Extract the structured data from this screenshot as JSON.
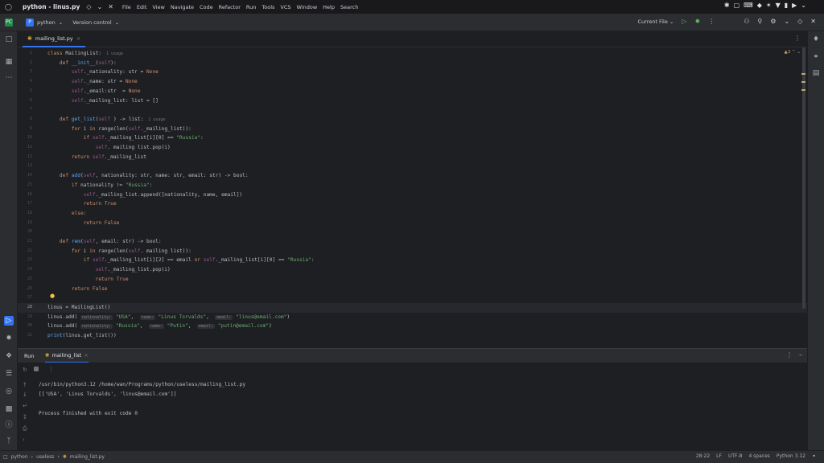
{
  "window": {
    "title": "python - linus.py",
    "menu": [
      "File",
      "Edit",
      "View",
      "Navigate",
      "Code",
      "Refactor",
      "Run",
      "Tools",
      "VCS",
      "Window",
      "Help",
      "Search"
    ]
  },
  "toolbar": {
    "project_badge": "P",
    "project_name": "python",
    "vcs_label": "Version control",
    "run_config": "Current File"
  },
  "editor": {
    "tab_label": "mailing_list.py",
    "warnings": "▲3",
    "line_numbers": [
      "1",
      "2",
      "3",
      "4",
      "5",
      "6",
      "7",
      "8",
      "9",
      "10",
      "11",
      "12",
      "13",
      "14",
      "15",
      "16",
      "17",
      "18",
      "19",
      "20",
      "21",
      "22",
      "23",
      "24",
      "25",
      "26",
      "27",
      "28",
      "29",
      "30",
      "31"
    ],
    "current_line_index": 27,
    "lines": [
      [
        [
          "kw",
          "class "
        ],
        [
          "",
          "MailingList:"
        ],
        [
          "hint",
          "  1 usage"
        ]
      ],
      [
        [
          "",
          "    "
        ],
        [
          "kw",
          "def "
        ],
        [
          "fn",
          "__init__"
        ],
        [
          "",
          "("
        ],
        [
          "self",
          "self"
        ],
        [
          "",
          "):"
        ]
      ],
      [
        [
          "",
          "        "
        ],
        [
          "self",
          "self"
        ],
        [
          "",
          "._nationality: str = "
        ],
        [
          "kw",
          "None"
        ]
      ],
      [
        [
          "",
          "        "
        ],
        [
          "self",
          "self"
        ],
        [
          "",
          "._name: str = "
        ],
        [
          "kw",
          "None"
        ]
      ],
      [
        [
          "",
          "        "
        ],
        [
          "self",
          "self"
        ],
        [
          "",
          "._email:str  = "
        ],
        [
          "kw",
          "None"
        ]
      ],
      [
        [
          "",
          "        "
        ],
        [
          "self",
          "self"
        ],
        [
          "",
          "._mailing_list: list = []"
        ]
      ],
      [
        [
          "",
          ""
        ]
      ],
      [
        [
          "",
          "    "
        ],
        [
          "kw",
          "def "
        ],
        [
          "fn",
          "get_list"
        ],
        [
          "",
          "("
        ],
        [
          "self",
          "self"
        ],
        [
          "",
          " ) -> list:"
        ],
        [
          "hint",
          "  1 usage"
        ]
      ],
      [
        [
          "",
          "        "
        ],
        [
          "kw",
          "for "
        ],
        [
          "",
          "i "
        ],
        [
          "kw",
          "in "
        ],
        [
          "",
          "range(len("
        ],
        [
          "self",
          "self"
        ],
        [
          "",
          "._mailing_list)):"
        ]
      ],
      [
        [
          "",
          "            "
        ],
        [
          "kw",
          "if "
        ],
        [
          "self",
          "self"
        ],
        [
          "",
          "._mailing_list[i][0] == "
        ],
        [
          "str",
          "\"Russia\""
        ],
        [
          "",
          ":"
        ]
      ],
      [
        [
          "",
          "                "
        ],
        [
          "self",
          "self"
        ],
        [
          "",
          ". mailing list.pop(i)"
        ]
      ],
      [
        [
          "",
          "        "
        ],
        [
          "kw",
          "return "
        ],
        [
          "self",
          "self"
        ],
        [
          "",
          "._mailing_list"
        ]
      ],
      [
        [
          "",
          ""
        ]
      ],
      [
        [
          "",
          "    "
        ],
        [
          "kw",
          "def "
        ],
        [
          "fn",
          "add"
        ],
        [
          "",
          "("
        ],
        [
          "self",
          "self"
        ],
        [
          "",
          ", nationality: str, name: str, email: str) -> bool:"
        ]
      ],
      [
        [
          "",
          "        "
        ],
        [
          "kw",
          "if "
        ],
        [
          "",
          "nationality != "
        ],
        [
          "str",
          "\"Russia\""
        ],
        [
          "",
          ":"
        ]
      ],
      [
        [
          "",
          "            "
        ],
        [
          "self",
          "self"
        ],
        [
          "",
          "._mailing_list.append([nationality, name, email])"
        ]
      ],
      [
        [
          "",
          "            "
        ],
        [
          "kw",
          "return True"
        ]
      ],
      [
        [
          "",
          "        "
        ],
        [
          "kw",
          "else"
        ],
        [
          "",
          ":"
        ]
      ],
      [
        [
          "",
          "            "
        ],
        [
          "kw",
          "return False"
        ]
      ],
      [
        [
          "",
          ""
        ]
      ],
      [
        [
          "",
          "    "
        ],
        [
          "kw",
          "def "
        ],
        [
          "fn",
          "rem"
        ],
        [
          "",
          "("
        ],
        [
          "self",
          "self"
        ],
        [
          "",
          ", email: str) -> bool:"
        ]
      ],
      [
        [
          "",
          "        "
        ],
        [
          "kw",
          "for "
        ],
        [
          "",
          "i "
        ],
        [
          "kw",
          "in "
        ],
        [
          "",
          "range(len("
        ],
        [
          "self",
          "self"
        ],
        [
          "",
          ". mailing list)):"
        ]
      ],
      [
        [
          "",
          "            "
        ],
        [
          "kw",
          "if "
        ],
        [
          "self",
          "self"
        ],
        [
          "",
          "._mailing_list[i][2] == email "
        ],
        [
          "kw",
          "or "
        ],
        [
          "self",
          "self"
        ],
        [
          "",
          "._mailing_list[i][0] == "
        ],
        [
          "str",
          "\"Russia\""
        ],
        [
          "",
          ":"
        ]
      ],
      [
        [
          "",
          "                "
        ],
        [
          "self",
          "self"
        ],
        [
          "",
          "._mailing_list.pop(i)"
        ]
      ],
      [
        [
          "",
          "                "
        ],
        [
          "kw",
          "return True"
        ]
      ],
      [
        [
          "",
          "        "
        ],
        [
          "kw",
          "return False"
        ]
      ],
      [
        [
          "",
          ""
        ]
      ],
      [
        [
          "",
          "linus = MailingList()"
        ]
      ],
      [
        [
          "",
          "linus.add( "
        ],
        [
          "ihint",
          "nationality:"
        ],
        [
          "",
          " "
        ],
        [
          "str",
          "\"USA\""
        ],
        [
          "",
          ",  "
        ],
        [
          "ihint",
          "name:"
        ],
        [
          "",
          " "
        ],
        [
          "str",
          "\"Linus Torvalds\""
        ],
        [
          "",
          ",  "
        ],
        [
          "ihint",
          "email:"
        ],
        [
          "",
          " "
        ],
        [
          "str",
          "\"linus@email.com\""
        ],
        [
          "",
          ")"
        ]
      ],
      [
        [
          "",
          "linus.add( "
        ],
        [
          "ihint",
          "nationality:"
        ],
        [
          "",
          " "
        ],
        [
          "str",
          "\"Russia\""
        ],
        [
          "",
          ",  "
        ],
        [
          "ihint",
          "name:"
        ],
        [
          "",
          " "
        ],
        [
          "str",
          "\"Putin\""
        ],
        [
          "",
          ",  "
        ],
        [
          "ihint",
          "email:"
        ],
        [
          "",
          " "
        ],
        [
          "str",
          "\"putin@email.com\""
        ],
        [
          "",
          ")"
        ]
      ],
      [
        [
          "fn",
          "print"
        ],
        [
          "",
          "(linus.get_list())"
        ]
      ]
    ]
  },
  "run": {
    "label": "Run",
    "tab_label": "mailing_list",
    "output": [
      "/usr/bin/python3.12 /home/wan/Programs/python/useless/mailing_list.py",
      "[['USA', 'Linus Torvalds', 'linus@email.com']]",
      "",
      "Process finished with exit code 0"
    ]
  },
  "status": {
    "crumbs": [
      "python",
      "useless",
      "mailing_list.py"
    ],
    "position": "28:22",
    "line_sep": "LF",
    "encoding": "UTF-8",
    "indent": "4 spaces",
    "interpreter": "Python 3.12"
  },
  "colors": {
    "accent": "#3574f0",
    "keyword": "#cf8e6d",
    "string": "#6aab73",
    "function": "#56a8f5",
    "self": "#94558d"
  }
}
